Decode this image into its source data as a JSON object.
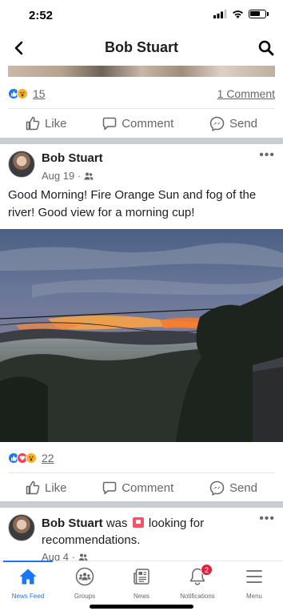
{
  "status_bar": {
    "time": "2:52"
  },
  "header": {
    "title": "Bob Stuart"
  },
  "prev_post": {
    "reactions_count": "15",
    "comments_link": "1 Comment"
  },
  "actions": {
    "like": "Like",
    "comment": "Comment",
    "send": "Send"
  },
  "post1": {
    "author": "Bob Stuart",
    "date": "Aug 19 ·",
    "text": "Good Morning! Fire Orange Sun and fog of the river! Good view for a morning cup!",
    "reactions_count": "22"
  },
  "post2": {
    "author": "Bob Stuart",
    "was": " was ",
    "activity": " looking for recommendations.",
    "date": "Aug 4 ·"
  },
  "tabs": [
    {
      "label": "News Feed",
      "icon": "home-icon"
    },
    {
      "label": "Groups",
      "icon": "groups-icon"
    },
    {
      "label": "News",
      "icon": "news-icon"
    },
    {
      "label": "Notifications",
      "icon": "bell-icon"
    },
    {
      "label": "Menu",
      "icon": "hamburger-icon"
    }
  ],
  "notifications_badge": "2",
  "colors": {
    "accent": "#1877f2",
    "badge": "#e41e3f",
    "muted": "#65676b"
  }
}
